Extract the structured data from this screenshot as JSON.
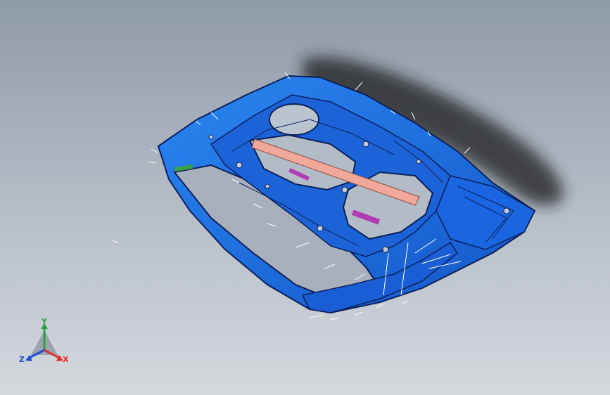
{
  "viewport": {
    "background_top": "#8f9aa8",
    "background_bottom": "#d5d9de",
    "model": {
      "name": "car-door-inner-panel",
      "color": "#1f6fe0",
      "edge_color": "#0a1f5a",
      "bar_color": "#f0a89a",
      "accent_color": "#b03bb5"
    },
    "triad": {
      "y_label": "Y",
      "x_label": "X",
      "z_label": "Z",
      "y_color": "#2ea043",
      "x_color": "#e03131",
      "z_color": "#1c4fd6"
    }
  }
}
